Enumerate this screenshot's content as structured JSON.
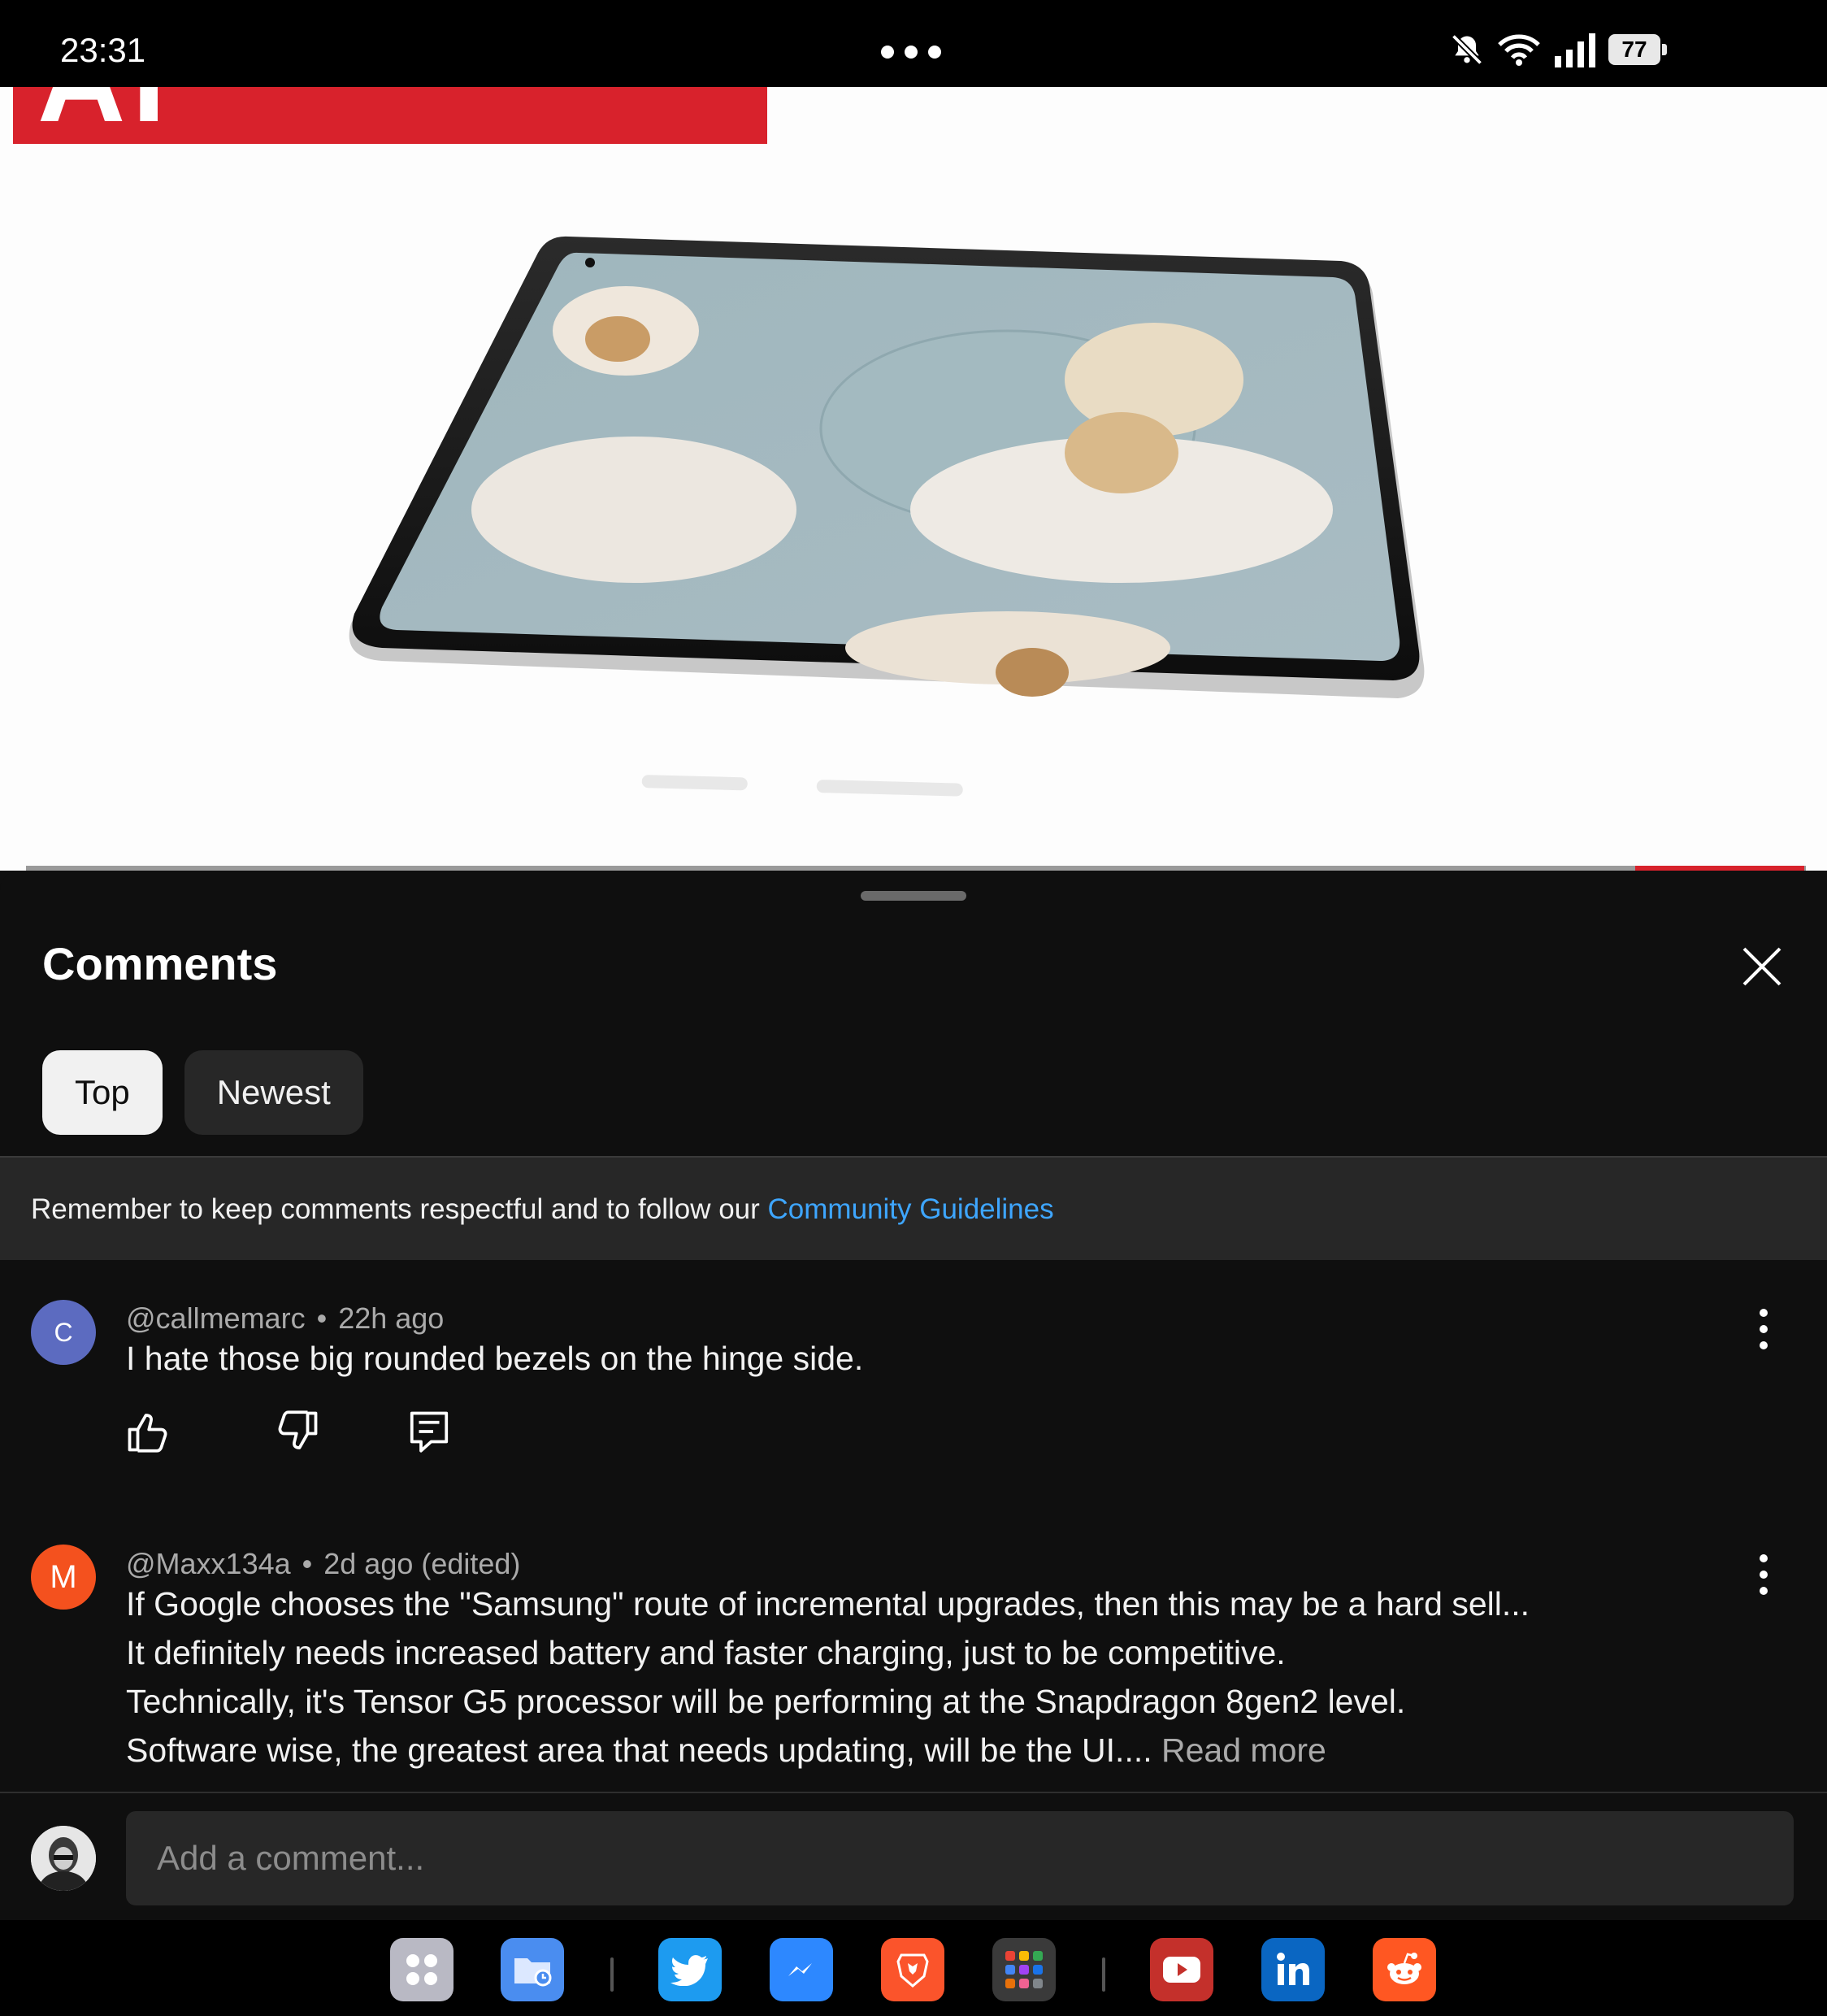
{
  "status_bar": {
    "time": "23:31",
    "battery": "77",
    "icons": [
      "mute-icon",
      "wifi-icon",
      "signal-icon",
      "battery-icon"
    ]
  },
  "video": {
    "banner_text": "AI EXCLUSIVE",
    "accent_color": "#d8222c"
  },
  "comments_panel": {
    "title": "Comments",
    "tabs": [
      {
        "label": "Top",
        "selected": true
      },
      {
        "label": "Newest",
        "selected": false
      }
    ],
    "guidelines": {
      "text": "Remember to keep comments respectful and to follow our ",
      "link": "Community Guidelines"
    },
    "comments": [
      {
        "avatar_letter": "C",
        "avatar_color": "#5c6bc0",
        "author": "@callmemarc",
        "time": "22h ago",
        "text": "I hate those big rounded bezels on the hinge side."
      },
      {
        "avatar_letter": "M",
        "avatar_color": "#f4511e",
        "author": "@Maxx134a",
        "time": "2d ago (edited)",
        "lines": [
          "If Google chooses the \"Samsung\" route of incremental upgrades, then this may be a hard sell...",
          "It definitely needs increased battery and faster charging, just to be competitive.",
          "Technically, it's Tensor G5 processor will be performing at the Snapdragon 8gen2 level.",
          "Software wise, the greatest area that needs updating, will be the UI.... "
        ],
        "read_more": "Read more"
      }
    ],
    "composer": {
      "placeholder": "Add a comment..."
    }
  },
  "dock": {
    "apps": [
      "app-drawer-icon",
      "files-icon",
      "twitter-icon",
      "messenger-icon",
      "brave-icon",
      "app-folder-icon",
      "youtube-icon",
      "linkedin-icon",
      "reddit-icon"
    ]
  }
}
